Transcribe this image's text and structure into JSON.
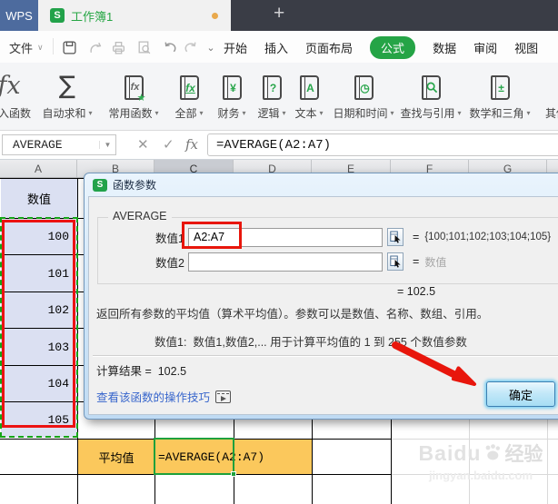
{
  "titlebar": {
    "app_name": "WPS",
    "logo_letter": "S",
    "document_tab": "工作簿1",
    "new_tab_glyph": "+"
  },
  "menubar": {
    "file_label": "文件",
    "tabs": [
      "开始",
      "插入",
      "页面布局",
      "公式",
      "数据",
      "审阅",
      "视图"
    ],
    "active_tab": "公式"
  },
  "ribbon": {
    "items": [
      {
        "label": "插入函数",
        "icon": "fx-large",
        "glyph": "fx"
      },
      {
        "label": "自动求和",
        "icon": "sigma",
        "glyph": "∑"
      },
      {
        "label": "常用函数",
        "icon": "book-fx-star",
        "glyph": "fx"
      },
      {
        "label": "全部",
        "icon": "book-fx",
        "glyph": "fx"
      },
      {
        "label": "财务",
        "icon": "book-yen",
        "glyph": "¥"
      },
      {
        "label": "逻辑",
        "icon": "book-question",
        "glyph": "?"
      },
      {
        "label": "文本",
        "icon": "book-a",
        "glyph": "A"
      },
      {
        "label": "日期和时间",
        "icon": "book-clock",
        "glyph": "◷"
      },
      {
        "label": "查找与引用",
        "icon": "book-magnifier",
        "glyph": ""
      },
      {
        "label": "数学和三角",
        "icon": "book-plusminus",
        "glyph": "±"
      },
      {
        "label": "其他函数",
        "icon": "book",
        "glyph": ""
      }
    ]
  },
  "formula_bar": {
    "name_box": "AVERAGE",
    "formula": "=AVERAGE(A2:A7)"
  },
  "sheet": {
    "columns": [
      "A",
      "B",
      "C",
      "D",
      "E",
      "F",
      "G"
    ],
    "selected_column": "C",
    "header_cell": "数值",
    "values": [
      100,
      101,
      102,
      103,
      104,
      105
    ],
    "avg_label": "平均值",
    "avg_formula": "=AVERAGE(A2:A7)"
  },
  "dialog": {
    "title": "函数参数",
    "function_name": "AVERAGE",
    "equals": "=",
    "args": [
      {
        "label": "数值1",
        "value": "A2:A7",
        "result": "{100;101;102;103;104;105}"
      },
      {
        "label": "数值2",
        "value": "",
        "result": "数值"
      }
    ],
    "overall_result": "=  102.5",
    "description": "返回所有参数的平均值（算术平均值）。参数可以是数值、名称、数组、引用。",
    "hint_label": "数值1:",
    "hint_text": "数值1,数值2,... 用于计算平均值的 1 到 255 个数值参数",
    "calc_label": "计算结果 =",
    "calc_value": "102.5",
    "tips_link": "查看该函数的操作技巧",
    "ok_label": "确定"
  },
  "watermark": {
    "brand": "Baidu",
    "suffix": "经验",
    "url": "jingyan.baidu.com"
  },
  "colors": {
    "accent_green": "#26a644",
    "wps_blue": "#4d6b9e",
    "annotation_red": "#e8160c",
    "ants_green": "#17a517",
    "cell_selection_fill": "#dbe0f2",
    "result_cell_fill": "#fbc85c",
    "link_blue": "#3866cc"
  }
}
